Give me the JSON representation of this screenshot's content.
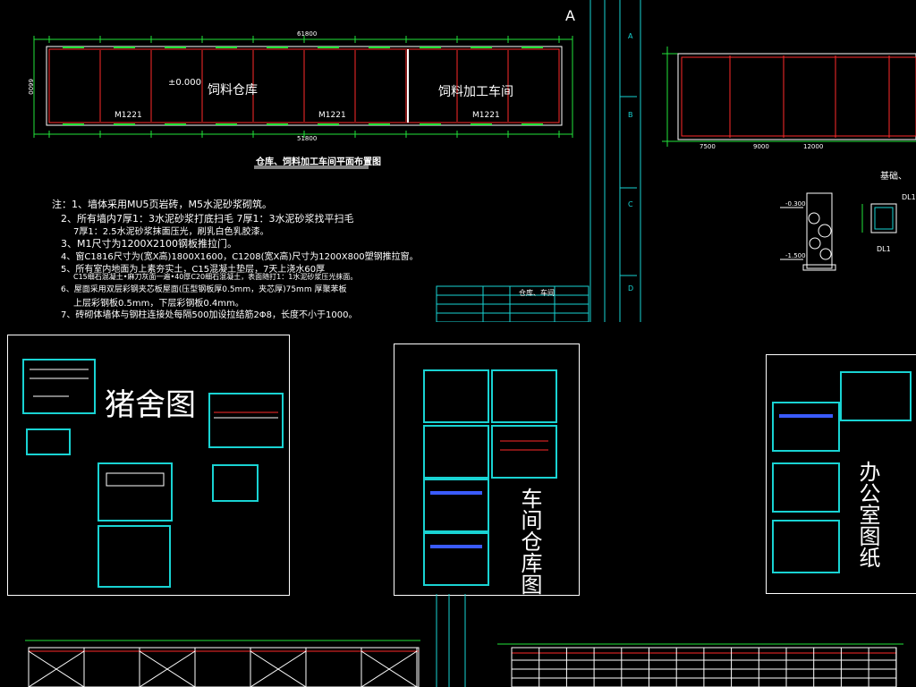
{
  "drawing_top": {
    "title": "仓库、饲料加工车间平面布置图",
    "room_warehouse": "饲料仓库",
    "room_workshop": "饲料加工车间",
    "elevation": "±0.000",
    "door_labels": [
      "M1221",
      "M1221",
      "M1221"
    ],
    "overall_dim_top": "61800",
    "overall_dim_bottom": "51800",
    "side_dim": "6600",
    "grid_marks": [
      "A",
      "B",
      "C",
      "D"
    ],
    "section_mark": "A"
  },
  "notes": [
    "注：1、墙体采用MU5页岩砖，M5水泥砂浆砌筑。",
    "2、所有墙内7厚1：3水泥砂浆打底扫毛 7厚1：3水泥砂浆找平扫毛",
    "7厚1：2.5水泥砂浆抹面压光，刷乳白色乳胶漆。",
    "3、M1尺寸为1200X2100钢板推拉门。",
    "4、窗C1816尺寸为(宽X高)1800X1600，C1208(宽X高)尺寸为1200X800塑钢推拉窗。",
    "5、所有室内地面为上素夯实土，C15混凝土垫层，7天上浇水60厚",
    "C15细石混凝土•麻刀灰面一遍•40厚C20细石混凝土，表面随打1：1水泥砂浆压光抹面。",
    "6、屋面采用双层彩钢夹芯板屋面(压型钢板厚0.5mm，夹芯厚)75mm 厚聚苯板",
    "上层彩钢板0.5mm，下层彩钢板0.4mm。",
    "7、砖砌体墙体与钢柱连接处每隔500加设拉结筋2Φ8，长度不小于1000。"
  ],
  "title_block": {
    "name": "仓库、车间"
  },
  "drawing_right": {
    "label_foundation": "基础、",
    "dl_labels": [
      "DL1",
      "DL1"
    ],
    "dims": [
      "7500",
      "9000",
      "12000"
    ],
    "elev_labels": [
      "-0.300",
      "-1.500"
    ]
  },
  "panels": {
    "pig": {
      "title": "猪舍图"
    },
    "workshop": {
      "title": "车间仓库图"
    },
    "office": {
      "title": "办公室图纸"
    }
  },
  "colors": {
    "background": "#000000",
    "cad_cyan": "#19d3d3",
    "cad_green": "#22e33a",
    "cad_red": "#ff2a2a",
    "cad_blue": "#3a5bff",
    "frame": "#ffffff"
  }
}
